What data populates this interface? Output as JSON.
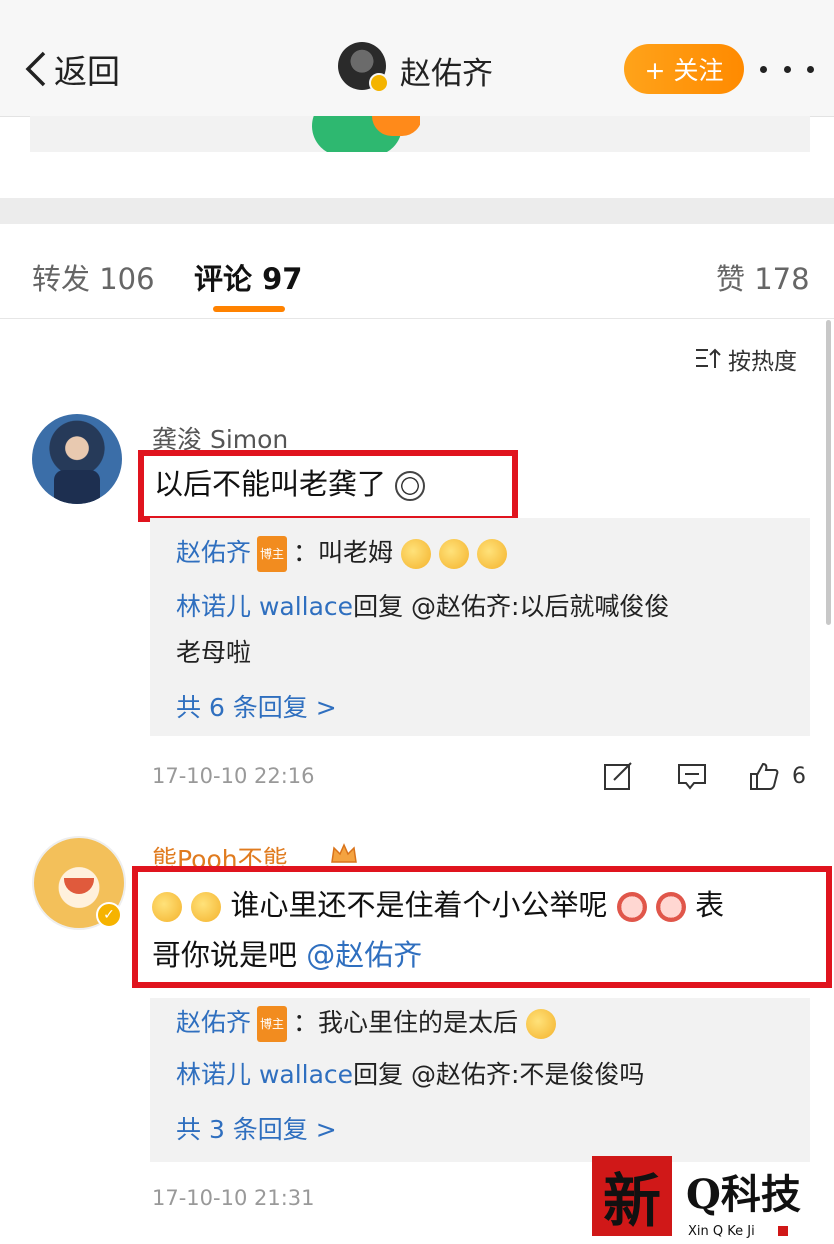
{
  "header": {
    "back_label": "返回",
    "user_name": "赵佑齐",
    "follow_label": "+ 关注"
  },
  "tabs": {
    "repost": "转发 106",
    "comments": "评论 97",
    "likes": "赞 178"
  },
  "sort_label": "按热度",
  "colors": {
    "accent": "#ff8200",
    "link": "#2f6fbf",
    "highlight_box": "#e0141e"
  },
  "comments": [
    {
      "author": "龚浚 Simon",
      "text": "以后不能叫老龚了",
      "replies": [
        {
          "author": "赵佑齐",
          "tag": "博主",
          "text": "：叫老姆"
        },
        {
          "author": "林诺儿 wallace",
          "text": "回复 @赵佑齐:以后就喊俊俊",
          "text2": "老母啦"
        }
      ],
      "more": "共 6 条回复 >",
      "time": "17-10-10 22:16",
      "like_count": "6"
    },
    {
      "author": "熊Pooh不熊",
      "text_line1": "谁心里还不是住着个小公举呢",
      "text_end1": "表",
      "text_line2": "哥你说是吧",
      "mention": "@赵佑齐",
      "replies": [
        {
          "author": "赵佑齐",
          "tag": "博主",
          "text": "：我心里住的是太后"
        },
        {
          "author": "林诺儿 wallace",
          "text": "回复 @赵佑齐:不是俊俊吗"
        }
      ],
      "more": "共 3 条回复 >",
      "time": "17-10-10 21:31"
    }
  ],
  "watermark": {
    "seal_char": "新",
    "title": "Q科技",
    "subtitle": "Xin Q Ke Ji"
  }
}
